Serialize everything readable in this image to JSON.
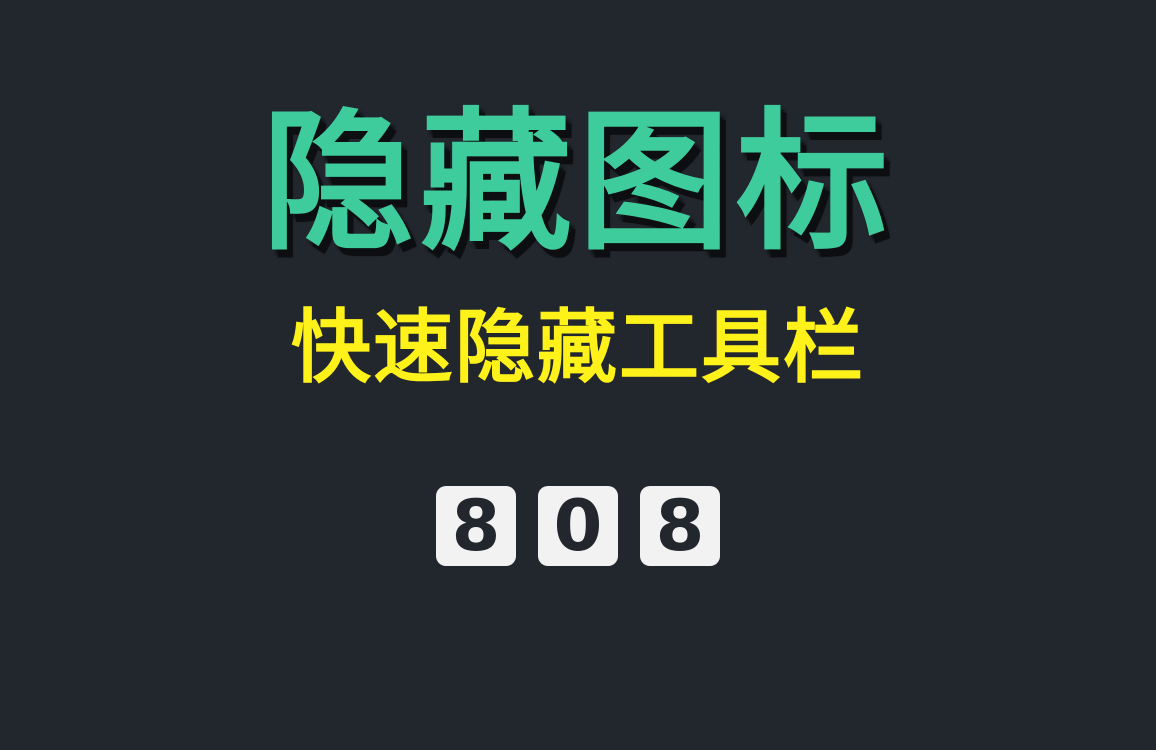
{
  "title": "隐藏图标",
  "subtitle": "快速隐藏工具栏",
  "episode": {
    "digits": [
      "8",
      "0",
      "8"
    ]
  },
  "colors": {
    "background": "#22262d",
    "title": "#3fcc9c",
    "subtitle": "#fff21a",
    "digit_tile": "#f2f2f2"
  }
}
